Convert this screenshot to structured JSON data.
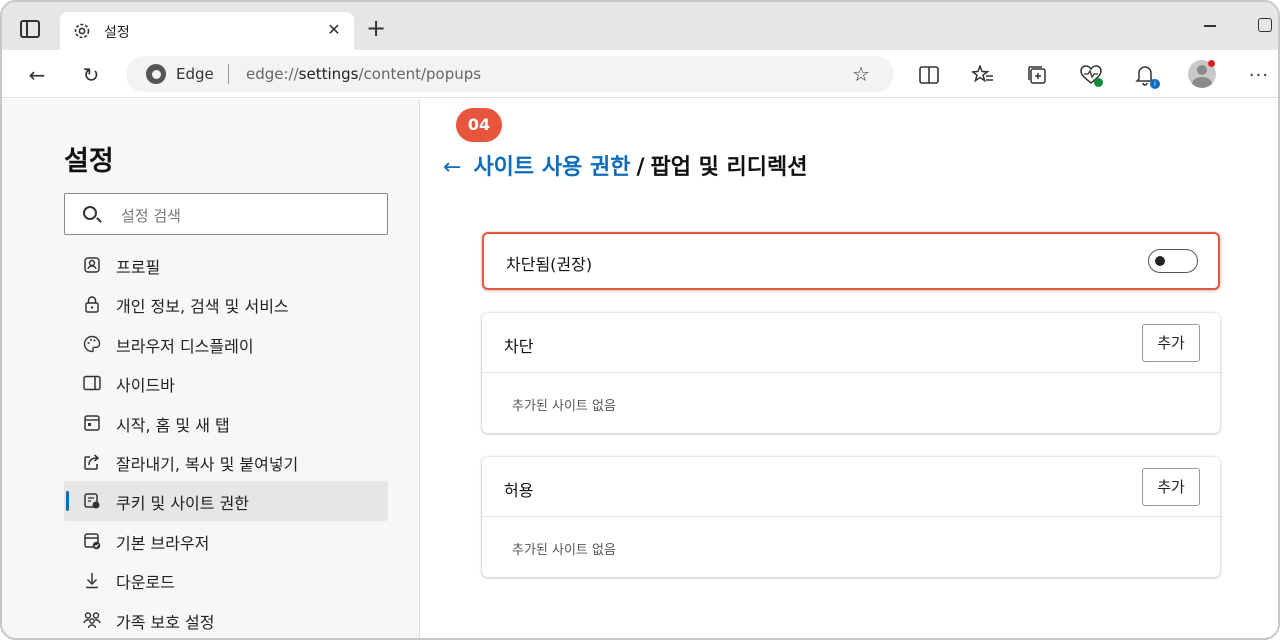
{
  "browser": {
    "tab_title": "설정",
    "address_brand": "Edge",
    "address_url_prefix": "edge://",
    "address_url_host": "settings",
    "address_url_path": "/content/popups"
  },
  "sidebar": {
    "title": "설정",
    "search_placeholder": "설정 검색",
    "items": [
      {
        "label": "프로필",
        "icon": "profile-icon"
      },
      {
        "label": "개인 정보, 검색 및 서비스",
        "icon": "lock-icon"
      },
      {
        "label": "브라우저 디스플레이",
        "icon": "palette-icon"
      },
      {
        "label": "사이드바",
        "icon": "sidebar-icon"
      },
      {
        "label": "시작, 홈 및 새 탭",
        "icon": "home-tab-icon"
      },
      {
        "label": "잘라내기, 복사 및 붙여넣기",
        "icon": "share-icon"
      },
      {
        "label": "쿠키 및 사이트 권한",
        "icon": "cookie-permissions-icon",
        "active": true
      },
      {
        "label": "기본 브라우저",
        "icon": "default-browser-icon"
      },
      {
        "label": "다운로드",
        "icon": "download-icon"
      },
      {
        "label": "가족 보호 설정",
        "icon": "family-icon"
      }
    ]
  },
  "main": {
    "breadcrumb_link": "사이트 사용 권한",
    "breadcrumb_separator": "/",
    "breadcrumb_current": "팝업 및 리디렉션",
    "callout_number": "04",
    "blocked_toggle_label": "차단됨(권장)",
    "blocked_toggle_on": false,
    "block_section": {
      "title": "차단",
      "add_label": "추가",
      "empty_text": "추가된 사이트 없음"
    },
    "allow_section": {
      "title": "허용",
      "add_label": "추가",
      "empty_text": "추가된 사이트 없음"
    }
  },
  "colors": {
    "accent": "#0f6cbd",
    "callout": "#e8553d"
  }
}
